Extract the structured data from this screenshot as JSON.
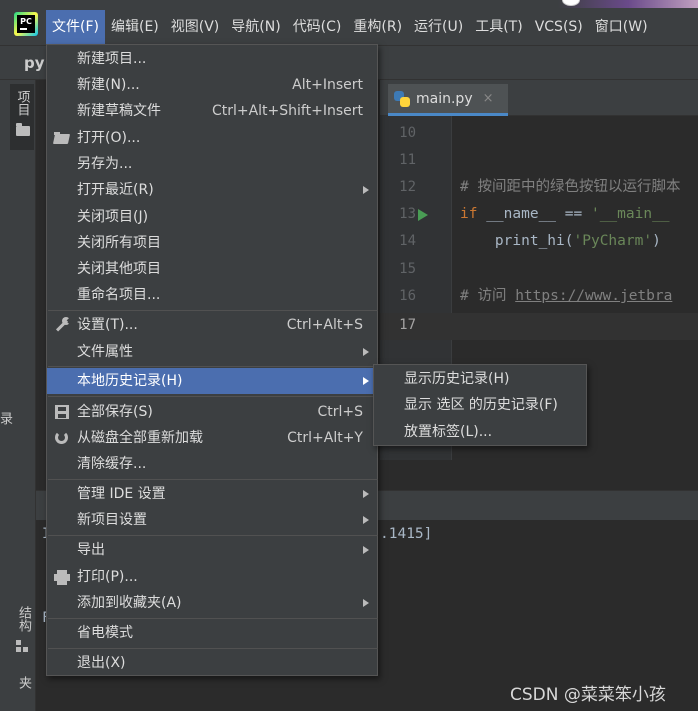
{
  "app": {
    "logo_icon": "pycharm-logo-icon",
    "logo_text": "PC",
    "project_name": "py"
  },
  "menubar": {
    "items": [
      {
        "label": "文件(F)"
      },
      {
        "label": "编辑(E)"
      },
      {
        "label": "视图(V)"
      },
      {
        "label": "导航(N)"
      },
      {
        "label": "代码(C)"
      },
      {
        "label": "重构(R)"
      },
      {
        "label": "运行(U)"
      },
      {
        "label": "工具(T)"
      },
      {
        "label": "VCS(S)"
      },
      {
        "label": "窗口(W)"
      }
    ]
  },
  "left_tabs": {
    "project": "项目",
    "structure": "结构",
    "favorites": "收藏夹",
    "edge_char": "录"
  },
  "editor": {
    "tab_label": "main.py",
    "tab_close": "×",
    "line_numbers": [
      "10",
      "11",
      "12",
      "13",
      "14",
      "15",
      "16",
      "17"
    ],
    "code": {
      "l12_comment": "# 按间距中的绿色按钮以运行脚本",
      "l13_kw": "if",
      "l13_mid": " __name__ == ",
      "l13_str": "'__main__",
      "l14_call": "    print_hi(",
      "l14_str": "'PyCharm'",
      "l14_end": ")",
      "l16_comment": "# 访问 ",
      "l16_link": "https://www.jetbra"
    }
  },
  "console": {
    "line_right": ".1415]",
    "line_left_1": "I",
    "line_left_2": "F"
  },
  "file_menu": {
    "items": [
      {
        "label": "新建项目..."
      },
      {
        "label": "新建(N)...",
        "shortcut": "Alt+Insert"
      },
      {
        "label": "新建草稿文件",
        "shortcut": "Ctrl+Alt+Shift+Insert"
      },
      {
        "label": "打开(O)...",
        "icon": "folder-open-icon"
      },
      {
        "label": "另存为..."
      },
      {
        "label": "打开最近(R)"
      },
      {
        "label": "关闭项目(J)"
      },
      {
        "label": "关闭所有项目"
      },
      {
        "label": "关闭其他项目"
      },
      {
        "label": "重命名项目..."
      },
      {
        "label": "设置(T)...",
        "shortcut": "Ctrl+Alt+S",
        "icon": "wrench-icon"
      },
      {
        "label": "文件属性"
      },
      {
        "label": "本地历史记录(H)"
      },
      {
        "label": "全部保存(S)",
        "shortcut": "Ctrl+S",
        "icon": "save-icon"
      },
      {
        "label": "从磁盘全部重新加载",
        "shortcut": "Ctrl+Alt+Y",
        "icon": "reload-icon"
      },
      {
        "label": "清除缓存..."
      },
      {
        "label": "管理 IDE 设置"
      },
      {
        "label": "新项目设置"
      },
      {
        "label": "导出"
      },
      {
        "label": "打印(P)...",
        "icon": "print-icon"
      },
      {
        "label": "添加到收藏夹(A)"
      },
      {
        "label": "省电模式"
      },
      {
        "label": "退出(X)"
      }
    ]
  },
  "history_submenu": {
    "items": [
      {
        "label": "显示历史记录(H)"
      },
      {
        "label": "显示 选区 的历史记录(F)"
      },
      {
        "label": "放置标签(L)..."
      }
    ]
  },
  "watermark": "CSDN @菜菜笨小孩",
  "colors": {
    "accent": "#4b6eaf",
    "background": "#2b2b2b",
    "panel": "#3c3f41"
  }
}
